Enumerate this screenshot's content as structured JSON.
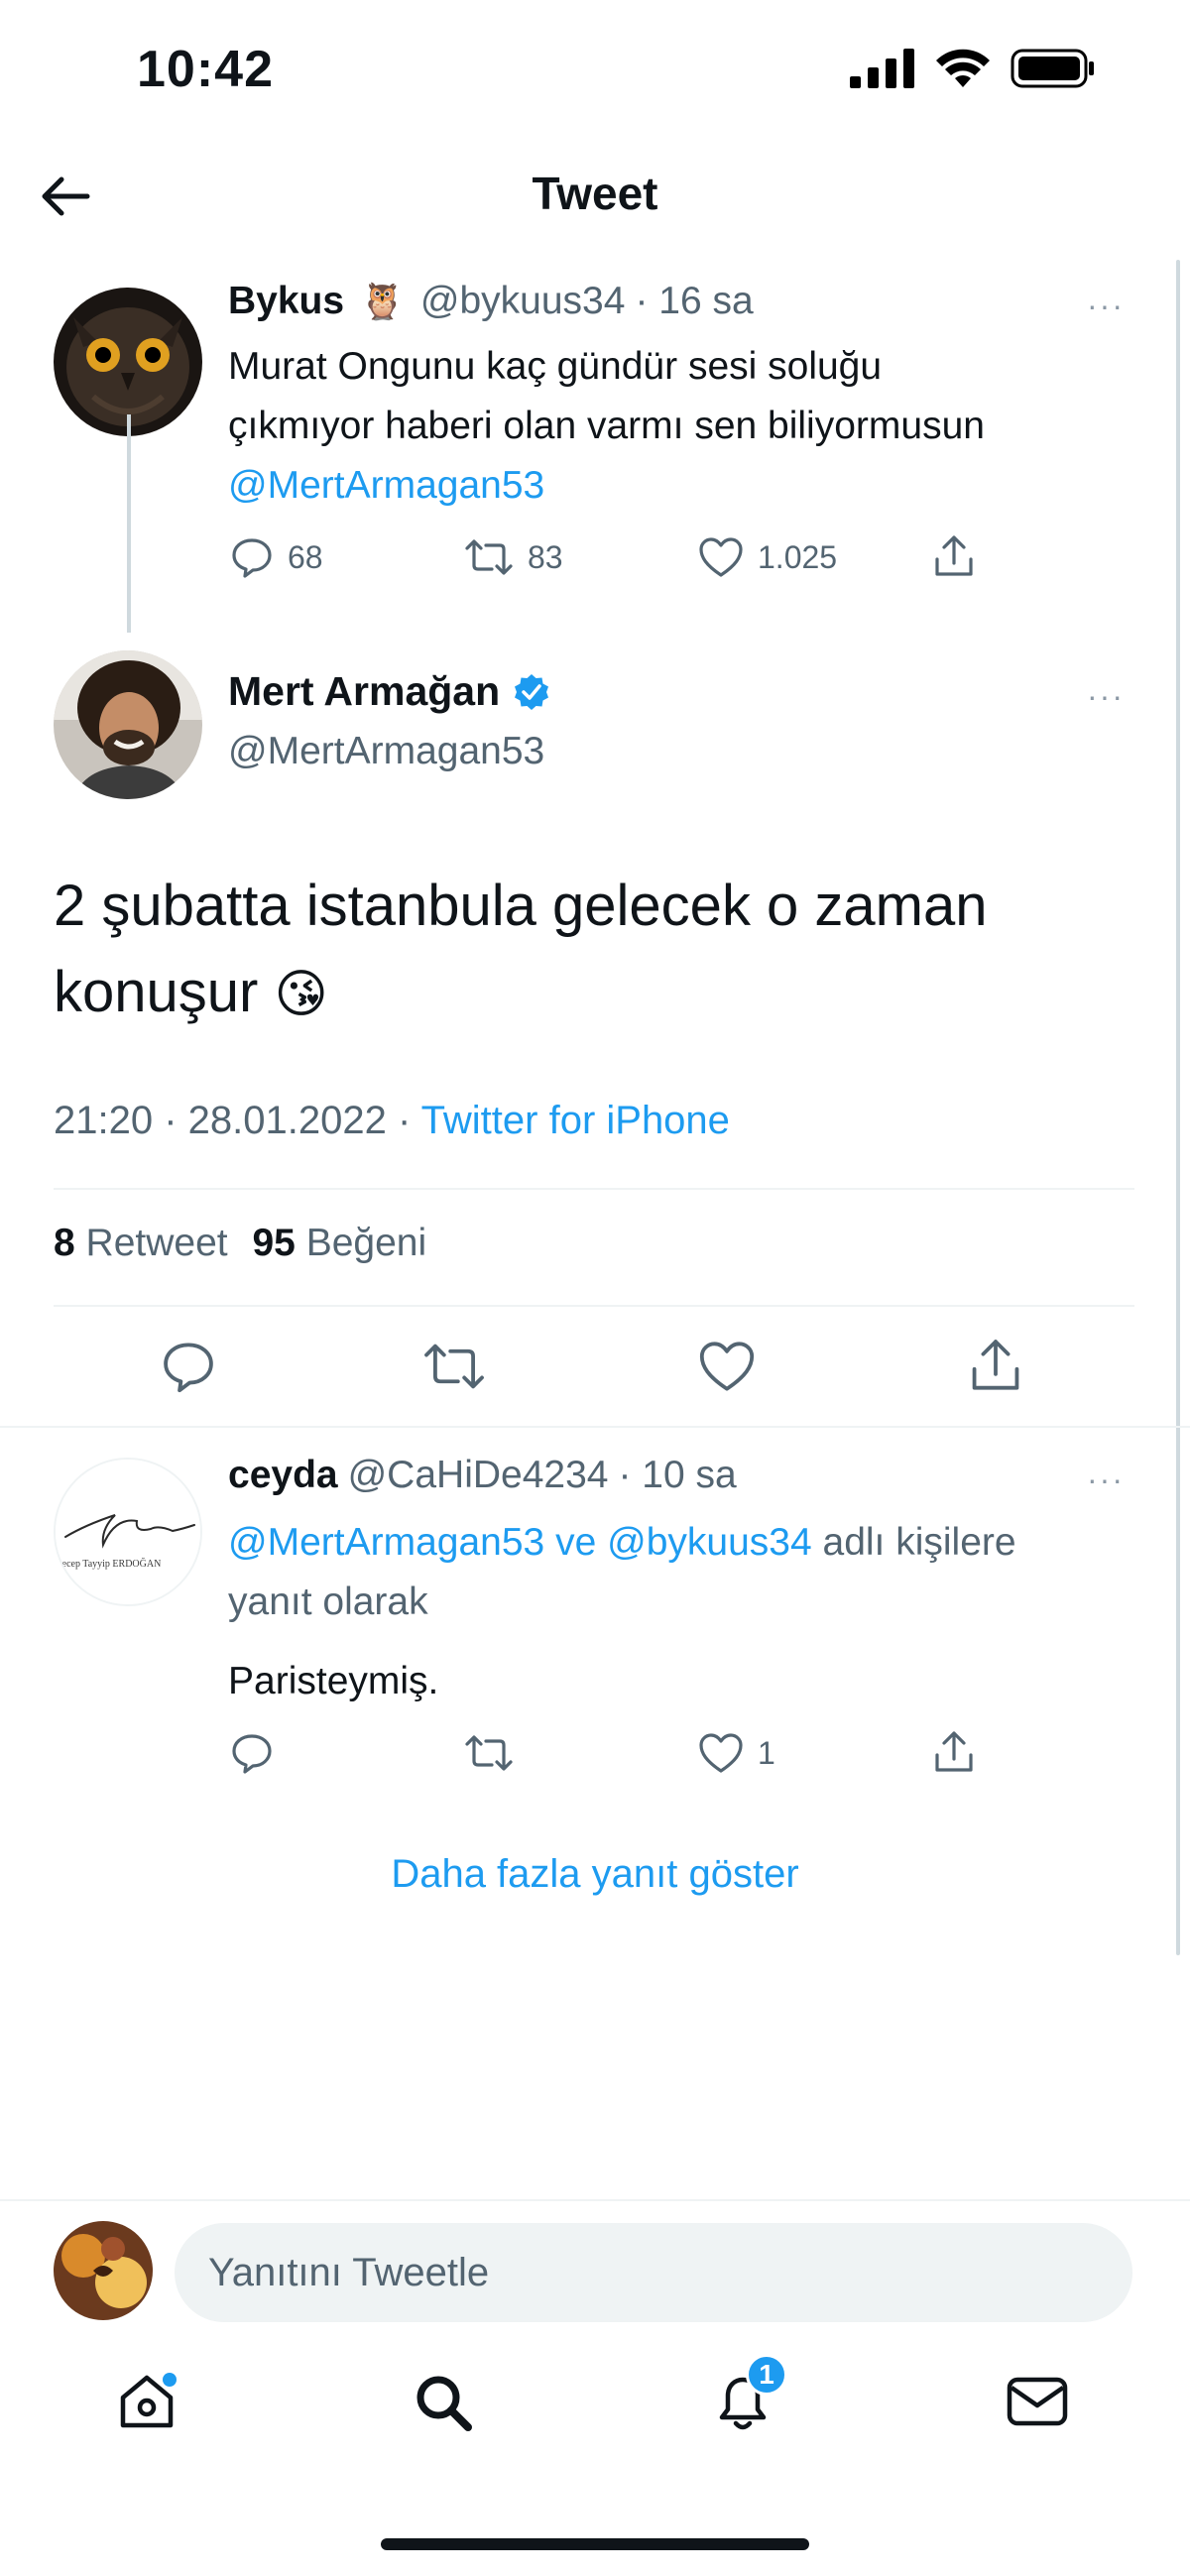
{
  "status_bar": {
    "time": "10:42"
  },
  "header": {
    "title": "Tweet"
  },
  "parent_tweet": {
    "name": "Bykus",
    "emoji": "🦉",
    "handle": "@bykuus34",
    "time": "· 16 sa",
    "text_line1": "Murat Ongunu kaç gündür sesi soluğu",
    "text_line2": "çıkmıyor haberi olan varmı sen biliyormusun",
    "mention": "@MertArmagan53",
    "replies": "68",
    "retweets": "83",
    "likes": "1.025"
  },
  "main_tweet": {
    "name": "Mert Armağan",
    "handle": "@MertArmagan53",
    "text_line1": "2 şubatta istanbula gelecek o zaman",
    "text_line2": "konuşur",
    "emoji": "😘",
    "time": "21:20 · 28.01.2022 ·",
    "source": "Twitter for iPhone",
    "retweet_count": "8",
    "retweet_label": "Retweet",
    "like_count": "95",
    "like_label": "Beğeni"
  },
  "reply_tweet": {
    "name": "ceyda",
    "handle": "@CaHiDe4234",
    "time": "· 10 sa",
    "mention1": "@MertArmagan53",
    "connector": "ve",
    "mention2": "@bykuus34",
    "replying_suffix": "adlı kişilere",
    "replying_line2": "yanıt olarak",
    "text": "Paristeymiş.",
    "likes": "1",
    "avatar_caption": "Recep Tayyip ERDOĞAN"
  },
  "show_more": "Daha fazla yanıt göster",
  "reply_box": {
    "placeholder": "Yanıtını Tweetle"
  },
  "tabbar": {
    "notifications_badge": "1"
  },
  "colors": {
    "accent": "#1d9bf0",
    "text": "#0f1419",
    "muted": "#536471"
  }
}
